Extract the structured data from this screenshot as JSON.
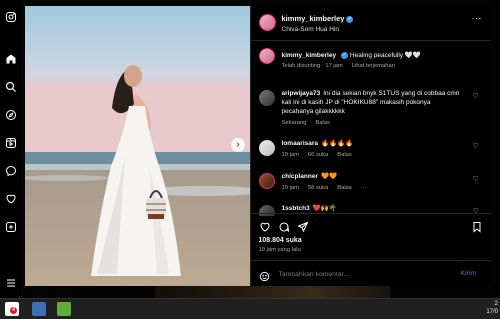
{
  "post": {
    "username": "kimmy_kimberley",
    "location": "Chiva-Som Hua Hin",
    "caption_user": "kimmy_kimberley",
    "caption_text": "Healing peacefully 🤍🤍",
    "caption_meta": [
      "Telah disunting · 17 jam",
      "Lihat terjemahan"
    ],
    "likes": "108.804 suka",
    "time_ago": "19 jam yang lalu"
  },
  "comments": [
    {
      "user": "aripwijaya73",
      "text": "Ini dia sekian bnyk S1TUS yang di cobbaa cmn kali ini di kasih JP di \"HOKIKU88\" makasih pokonya pecahanya gilakkkkkk",
      "meta": [
        "Sekarang",
        "Balas"
      ]
    },
    {
      "user": "lomaarisara",
      "text": "🔥🔥🔥🔥",
      "meta": [
        "19 jam",
        "66 suka",
        "Balas"
      ]
    },
    {
      "user": "chicplanner",
      "text": "🧡🧡",
      "meta": [
        "19 jam",
        "58 suka",
        "Balas",
        "···"
      ]
    },
    {
      "user": "1ssbtch3",
      "text": "❤️🙌🌴",
      "meta": []
    }
  ],
  "add_comment": {
    "placeholder": "Tambahkan komentar...",
    "post_label": "Kirim"
  },
  "taskbar": {
    "badge": "4",
    "clock": [
      "2",
      "17/0"
    ]
  },
  "colors": {
    "verified": "#3897f0",
    "link": "#4a7fbf",
    "ring": "#e1306c"
  },
  "icons": [
    "instagram-icon",
    "home-icon",
    "search-icon",
    "explore-icon",
    "reels-icon",
    "messenger-icon",
    "heart-icon",
    "create-icon",
    "menu-icon",
    "heart-icon",
    "comment-icon",
    "share-icon",
    "bookmark-icon",
    "emoji-icon",
    "more-icon"
  ]
}
